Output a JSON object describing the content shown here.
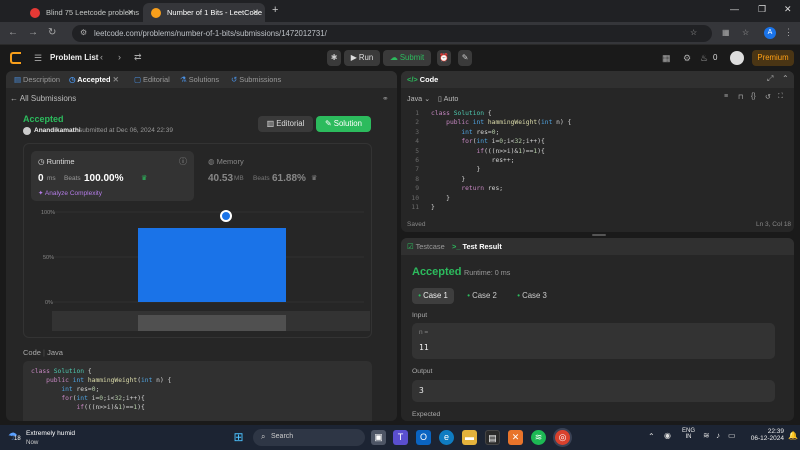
{
  "browser": {
    "tabs": [
      {
        "label": "Blind 75 Leetcode problems : D",
        "active": false,
        "favicon_color": "#e53935"
      },
      {
        "label": "Number of 1 Bits - LeetCode",
        "active": true,
        "favicon_color": "#f89f1b"
      }
    ],
    "new_tab": "+",
    "url": "leetcode.com/problems/number-of-1-bits/submissions/1472012731/",
    "profile_initial": "A"
  },
  "header": {
    "problem_list": "Problem List",
    "run": "Run",
    "submit": "Submit",
    "streak": "0",
    "premium": "Premium"
  },
  "left_tabs": [
    "Description",
    "Accepted",
    "Editorial",
    "Solutions",
    "Submissions"
  ],
  "submission": {
    "back_link": "All Submissions",
    "status": "Accepted",
    "user": "Anandikamathi",
    "submitted_text": "submitted at Dec 06, 2024 22:39",
    "editorial_btn": "Editorial",
    "solution_btn": "Solution",
    "runtime": {
      "label": "Runtime",
      "value": "0",
      "unit": "ms",
      "beats_label": "Beats",
      "beats": "100.00%",
      "analyze": "Analyze Complexity"
    },
    "memory": {
      "label": "Memory",
      "value": "40.53",
      "unit": "MB",
      "beats_label": "Beats",
      "beats": "61.88%"
    },
    "chart_ticks": [
      "100%",
      "50%",
      "0%"
    ]
  },
  "chart_data": {
    "type": "bar",
    "categories": [
      "0 ms"
    ],
    "values": [
      100
    ],
    "ylim": [
      0,
      100
    ],
    "yticks": [
      "0%",
      "50%",
      "100%"
    ],
    "marker_value": 100,
    "grid": true
  },
  "code_section": {
    "label": "Code",
    "lang": "Java",
    "lines": [
      "class Solution {",
      "    public int hammingWeight(int n) {",
      "        int res=0;",
      "        for(int i=0;i<32;i++){",
      "            if(((n>>i)&1)==1){"
    ]
  },
  "editor": {
    "title": "Code",
    "lang": "Java",
    "mode": "Auto",
    "lines": [
      "class Solution {",
      "    public int hammingWeight(int n) {",
      "        int res=0;",
      "        for(int i=0;i<32;i++){",
      "            if(((n>>i)&1)==1){",
      "                res++;",
      "            }",
      "        }",
      "        return res;",
      "    }",
      "}"
    ],
    "line_numbers": [
      "1",
      "2",
      "3",
      "4",
      "5",
      "6",
      "7",
      "8",
      "9",
      "10",
      "11"
    ],
    "saved": "Saved",
    "cursor": "Ln 3, Col 18"
  },
  "result": {
    "tab_testcase": "Testcase",
    "tab_result": "Test Result",
    "status": "Accepted",
    "runtime": "Runtime: 0 ms",
    "cases": [
      "Case 1",
      "Case 2",
      "Case 3"
    ],
    "input_label": "Input",
    "input_var": "n =",
    "input_value": "11",
    "output_label": "Output",
    "output_value": "3",
    "expected_label": "Expected"
  },
  "taskbar": {
    "weather_temp": "18",
    "weather_title": "Extremely humid",
    "weather_sub": "Now",
    "search": "Search",
    "lang_top": "ENG",
    "lang_bottom": "IN",
    "time": "22:39",
    "date": "06-12-2024"
  }
}
